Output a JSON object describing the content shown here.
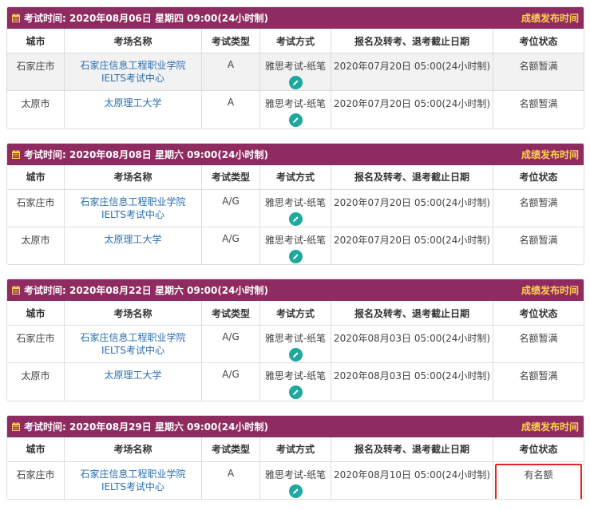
{
  "headers": {
    "city": "城市",
    "venue": "考场名称",
    "type": "考试类型",
    "method": "考试方式",
    "deadline": "报名及转考、退考截止日期",
    "status": "考位状态"
  },
  "result_link": "成绩发布时间",
  "sessions": [
    {
      "title": "考试时间: 2020年08月06日 星期四 09:00(24小时制)",
      "rows": [
        {
          "city": "石家庄市",
          "venue": "石家庄信息工程职业学院IELTS考试中心",
          "type": "A",
          "method": "雅思考试-纸笔",
          "deadline": "2020年07月20日 05:00(24小时制)",
          "status": "名额暂满"
        },
        {
          "city": "太原市",
          "venue": "太原理工大学",
          "type": "A",
          "method": "雅思考试-纸笔",
          "deadline": "2020年07月20日 05:00(24小时制)",
          "status": "名额暂满"
        }
      ]
    },
    {
      "title": "考试时间: 2020年08月08日 星期六 09:00(24小时制)",
      "rows": [
        {
          "city": "石家庄市",
          "venue": "石家庄信息工程职业学院IELTS考试中心",
          "type": "A/G",
          "method": "雅思考试-纸笔",
          "deadline": "2020年07月20日 05:00(24小时制)",
          "status": "名额暂满"
        },
        {
          "city": "太原市",
          "venue": "太原理工大学",
          "type": "A/G",
          "method": "雅思考试-纸笔",
          "deadline": "2020年07月20日 05:00(24小时制)",
          "status": "名额暂满"
        }
      ]
    },
    {
      "title": "考试时间: 2020年08月22日 星期六 09:00(24小时制)",
      "rows": [
        {
          "city": "石家庄市",
          "venue": "石家庄信息工程职业学院IELTS考试中心",
          "type": "A/G",
          "method": "雅思考试-纸笔",
          "deadline": "2020年08月03日 05:00(24小时制)",
          "status": "名额暂满"
        },
        {
          "city": "太原市",
          "venue": "太原理工大学",
          "type": "A/G",
          "method": "雅思考试-纸笔",
          "deadline": "2020年08月03日 05:00(24小时制)",
          "status": "名额暂满"
        }
      ]
    },
    {
      "title": "考试时间: 2020年08月29日 星期六 09:00(24小时制)",
      "rows": [
        {
          "city": "石家庄市",
          "venue": "石家庄信息工程职业学院IELTS考试中心",
          "type": "A",
          "method": "雅思考试-纸笔",
          "deadline": "2020年08月10日 05:00(24小时制)",
          "status": "有名额"
        }
      ]
    }
  ],
  "icons": {
    "header": "calendar-icon",
    "method": "pencil-icon"
  },
  "colors": {
    "header_bg": "#8e2b60",
    "link": "#2a6fb0",
    "result_link": "#ffd24d",
    "pencil_bg": "#1ea89e",
    "highlight": "#e52222"
  }
}
